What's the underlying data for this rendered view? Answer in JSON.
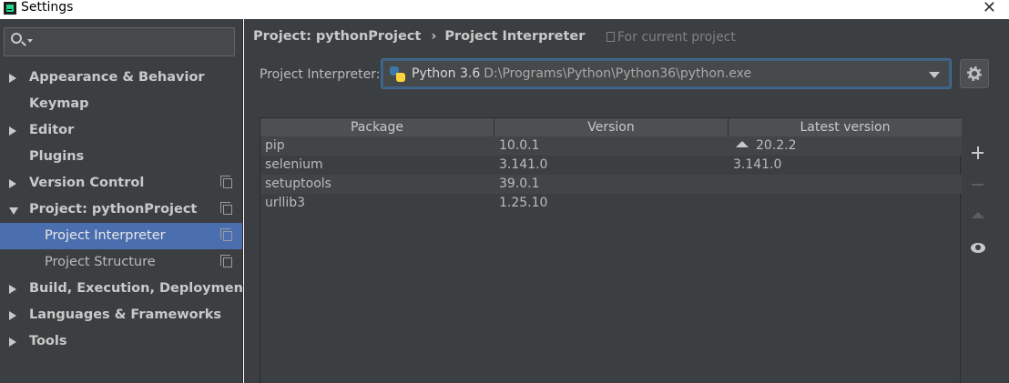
{
  "window": {
    "title": "Settings",
    "close_glyph": "✕"
  },
  "sidebar": {
    "search_placeholder": "",
    "items": [
      {
        "label": "Appearance & Behavior",
        "arrow": "right"
      },
      {
        "label": "Keymap"
      },
      {
        "label": "Editor",
        "arrow": "right"
      },
      {
        "label": "Plugins"
      },
      {
        "label": "Version Control",
        "arrow": "right",
        "icon": "copy-icon"
      },
      {
        "label": "Project: pythonProject",
        "arrow": "down",
        "icon": "copy-icon"
      },
      {
        "label": "Project Interpreter",
        "child": true,
        "selected": true,
        "icon": "copy-icon"
      },
      {
        "label": "Project Structure",
        "child": true,
        "icon": "copy-icon"
      },
      {
        "label": "Build, Execution, Deployment",
        "arrow": "right"
      },
      {
        "label": "Languages & Frameworks",
        "arrow": "right"
      },
      {
        "label": "Tools",
        "arrow": "right"
      }
    ]
  },
  "main": {
    "breadcrumb": {
      "root": "Project: pythonProject",
      "separator": "›",
      "current": "Project Interpreter"
    },
    "for_current_project": "For current project",
    "interpreter_label": "Project Interpreter:",
    "interpreter": {
      "name": "Python 3.6",
      "path": "D:\\Programs\\Python\\Python36\\python.exe"
    },
    "table": {
      "columns": [
        "Package",
        "Version",
        "Latest version"
      ],
      "rows": [
        {
          "package": "pip",
          "version": "10.0.1",
          "latest": "20.2.2",
          "upgrade": true
        },
        {
          "package": "selenium",
          "version": "3.141.0",
          "latest": "3.141.0",
          "upgrade": false
        },
        {
          "package": "setuptools",
          "version": "39.0.1",
          "latest": "",
          "upgrade": false
        },
        {
          "package": "urllib3",
          "version": "1.25.10",
          "latest": "",
          "upgrade": false
        }
      ]
    },
    "actions": [
      "add-icon",
      "remove-icon",
      "upgrade-icon",
      "show-early-releases-icon"
    ]
  },
  "colors": {
    "background": "#3c3f41",
    "selection": "#4b6eaf",
    "focus_border": "#3d6185"
  }
}
